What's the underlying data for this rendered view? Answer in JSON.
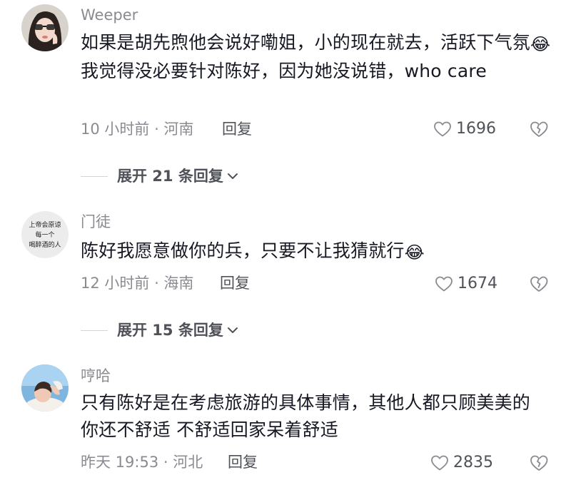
{
  "comments": [
    {
      "username": "Weeper",
      "text_before": "如果是胡先煦他会说好嘞姐，小的现在就去，活跃下气氛",
      "emoji": "😂",
      "text_after": "我觉得没必要针对陈好，因为她没说错，who care",
      "time_location": "10 小时前 · 河南",
      "reply_label": "回复",
      "likes": "1696",
      "expand_label": "展开 21 条回复"
    },
    {
      "username": "门徒",
      "avatar_text": [
        "上帝会原谅",
        "每一个",
        "喝醉酒的人"
      ],
      "text_before": "陈好我愿意做你的兵，只要不让我猜就行",
      "emoji": "😂",
      "text_after": "",
      "time_location": "12 小时前 · 海南",
      "reply_label": "回复",
      "likes": "1674",
      "expand_label": "展开 15 条回复"
    },
    {
      "username": "哼哈",
      "text_before": "只有陈好是在考虑旅游的具体事情，其他人都只顾美美的  你还不舒适  不舒适回家呆着舒适",
      "emoji": "",
      "text_after": "",
      "time_location": "昨天 19:53 · 河北",
      "reply_label": "回复",
      "likes": "2835"
    }
  ],
  "colors": {
    "text_primary": "#161823",
    "text_secondary": "#8a8b91",
    "text_action": "#505259",
    "divider": "#d4d5d8"
  },
  "icons": {
    "like": "heart-outline-icon",
    "dislike": "broken-heart-outline-icon",
    "expand": "chevron-down-icon"
  }
}
